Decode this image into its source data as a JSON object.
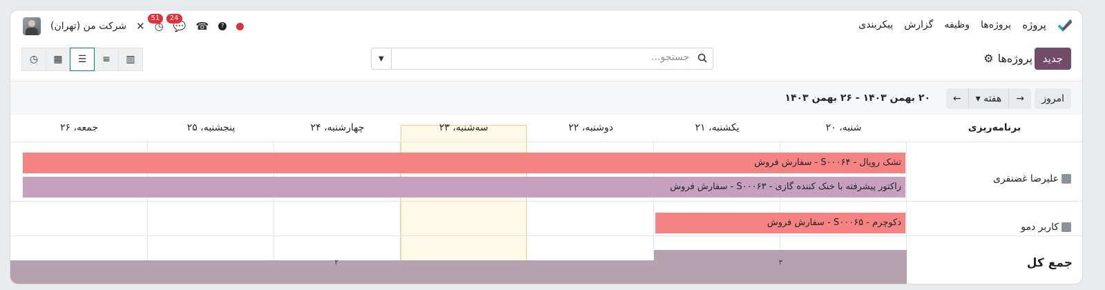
{
  "navbar": {
    "app_name": "پروژه",
    "menu": [
      "پروژه‌ها",
      "وظیفه",
      "گزارش",
      "پیکربندی"
    ],
    "company": "شرکت من (تهران)",
    "badges": {
      "chat": "24",
      "activity": "51"
    },
    "colors": {
      "brand": "#714b67",
      "badge": "#e0303a"
    }
  },
  "control": {
    "new_label": "جدید",
    "breadcrumb": "پروژه‌ها",
    "search_placeholder": "جستجو...",
    "views": [
      "gantt-icon",
      "list-icon",
      "kanban-icon",
      "calendar-icon",
      "activity-icon"
    ],
    "active_view": "gantt"
  },
  "gantt": {
    "today_label": "امروز",
    "scale_label": "هفته",
    "range_label": "۲۰ بهمن ۱۴۰۳ - ۲۶ بهمن ۱۴۰۳",
    "group_header": "برنامه‌ریزی",
    "days": [
      "شنبه، ۲۰",
      "یکشنبه، ۲۱",
      "دوشنبه، ۲۲",
      "سه‌شنبه، ۲۳",
      "چهارشنبه، ۲۴",
      "پنجشنبه، ۲۵",
      "جمعه، ۲۶"
    ],
    "today_index": 3,
    "rows": [
      {
        "label": "علیرضا غضنفری",
        "tasks": [
          {
            "name": "تشک رویال - S۰۰۰۶۴ - سفارش فروش",
            "color": "#f58383"
          },
          {
            "name": "راکتور پیشرفته با خنک کننده گازی - S۰۰۰۶۳ - سفارش فروش",
            "color": "#c7a0c0"
          }
        ]
      },
      {
        "label": "کاربر دمو",
        "tasks": [
          {
            "name": "دکوچرم - S۰۰۰۶۵ - سفارش فروش",
            "color": "#f58383"
          }
        ]
      }
    ],
    "total_label": "جمع کل",
    "totals": [
      "۳",
      "۲"
    ]
  }
}
